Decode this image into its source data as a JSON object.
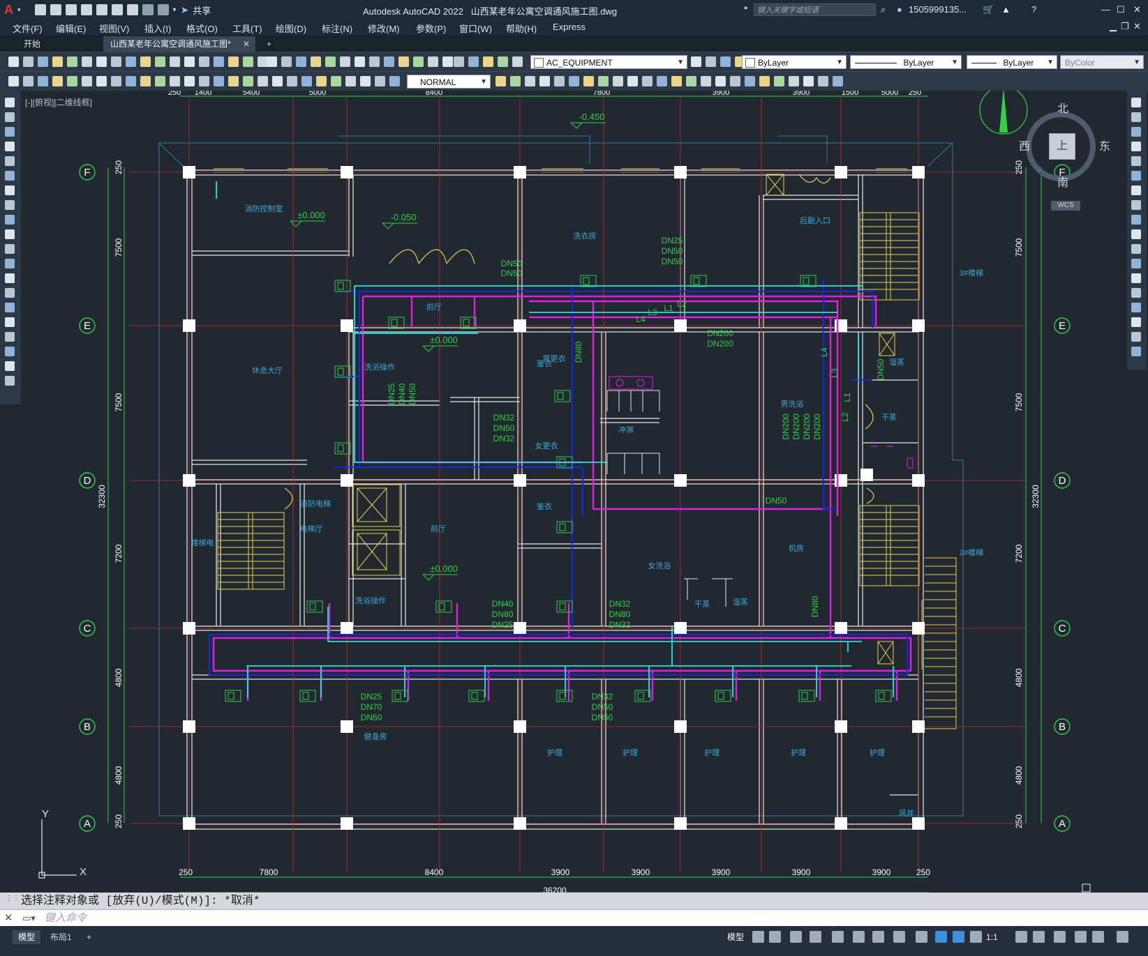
{
  "window": {
    "app_title": "Autodesk AutoCAD 2022",
    "file_title": "山西某老年公寓空调通风施工图.dwg",
    "search_placeholder": "键入关键字或短语",
    "user": "1505999135...",
    "share_label": "共享"
  },
  "menu": [
    "文件(F)",
    "编辑(E)",
    "视图(V)",
    "插入(I)",
    "格式(O)",
    "工具(T)",
    "绘图(D)",
    "标注(N)",
    "修改(M)",
    "参数(P)",
    "窗口(W)",
    "帮助(H)",
    "Express"
  ],
  "tabs": {
    "start": "开始",
    "drawing": "山西某老年公寓空调通风施工图*",
    "add": "+"
  },
  "toolbar": {
    "layer_name": "AC_EQUIPMENT",
    "color": "ByLayer",
    "linetype": "ByLayer",
    "lineweight": "ByLayer",
    "plotstyle": "ByColor",
    "dimstyle": "NORMAL"
  },
  "viewport_label": "[-][俯视][二维线框]",
  "viewcube": {
    "north": "北",
    "south": "南",
    "east": "东",
    "west": "西",
    "top": "上",
    "wcs": "WCS"
  },
  "drawing": {
    "axis_rows": [
      "F",
      "E",
      "D",
      "C",
      "B",
      "A"
    ],
    "left_dims": [
      "250",
      "7500",
      "7500",
      "7200",
      "4800",
      "4800",
      "250"
    ],
    "left_total": "32300",
    "right_dims": [
      "250",
      "7500",
      "7500",
      "7200",
      "4800",
      "4800",
      "250"
    ],
    "right_total": "32300",
    "bottom_dims": [
      "250",
      "7800",
      "8400",
      "3900",
      "3900",
      "3900",
      "3900",
      "3900",
      "250"
    ],
    "bottom_total": "36200",
    "top_dims": [
      "250",
      "1400",
      "5400",
      "5000",
      "8400",
      "7800",
      "3900",
      "3900",
      "1500",
      "5000",
      "250"
    ],
    "level_marks": [
      "-0.450",
      "±0.000",
      "-0.050",
      "±0.000",
      "±0.000"
    ],
    "rooms": [
      "消防控制室",
      "洗衣房",
      "后勤入口",
      "3#楼梯",
      "前厅",
      "男更衣",
      "洗浴操作",
      "休息大厅",
      "男洗浴",
      "干蒸",
      "冲淋",
      "女更衣",
      "消防电梯",
      "电梯厅",
      "前厅",
      "楼梯电",
      "洗浴操作",
      "女洗浴",
      "机房",
      "2#楼梯",
      "干蒸",
      "湿蒸",
      "健身房",
      "护理",
      "护理",
      "护理",
      "护理",
      "护理",
      "风井",
      "湿蒸",
      "鉴衣",
      "鉴衣"
    ],
    "pipe_labels": [
      "DN25",
      "DN50",
      "DN50",
      "DN50",
      "DN50",
      "L2",
      "L1",
      "L3",
      "L4",
      "DN200",
      "DN200",
      "DN80",
      "L4",
      "L3",
      "L1",
      "L2",
      "DN50",
      "DN25",
      "DN40",
      "DN50",
      "DN32",
      "DN50",
      "DN32",
      "DN200",
      "DN200",
      "DN200",
      "DN200",
      "DN50",
      "DN80",
      "DN40",
      "DN80",
      "DN25",
      "DN32",
      "DN80",
      "DN32",
      "DN25",
      "DN70",
      "DN50",
      "DN32",
      "DN50",
      "DN50"
    ],
    "ucs": {
      "x": "X",
      "y": "Y"
    }
  },
  "command": {
    "history": "选择注释对象或 [放弃(U)/模式(M)]: *取消*",
    "placeholder": "键入命令"
  },
  "status": {
    "model_tab": "模型",
    "layout_tab": "布局1",
    "add": "+",
    "model_label": "模型",
    "scale": "1:1"
  }
}
